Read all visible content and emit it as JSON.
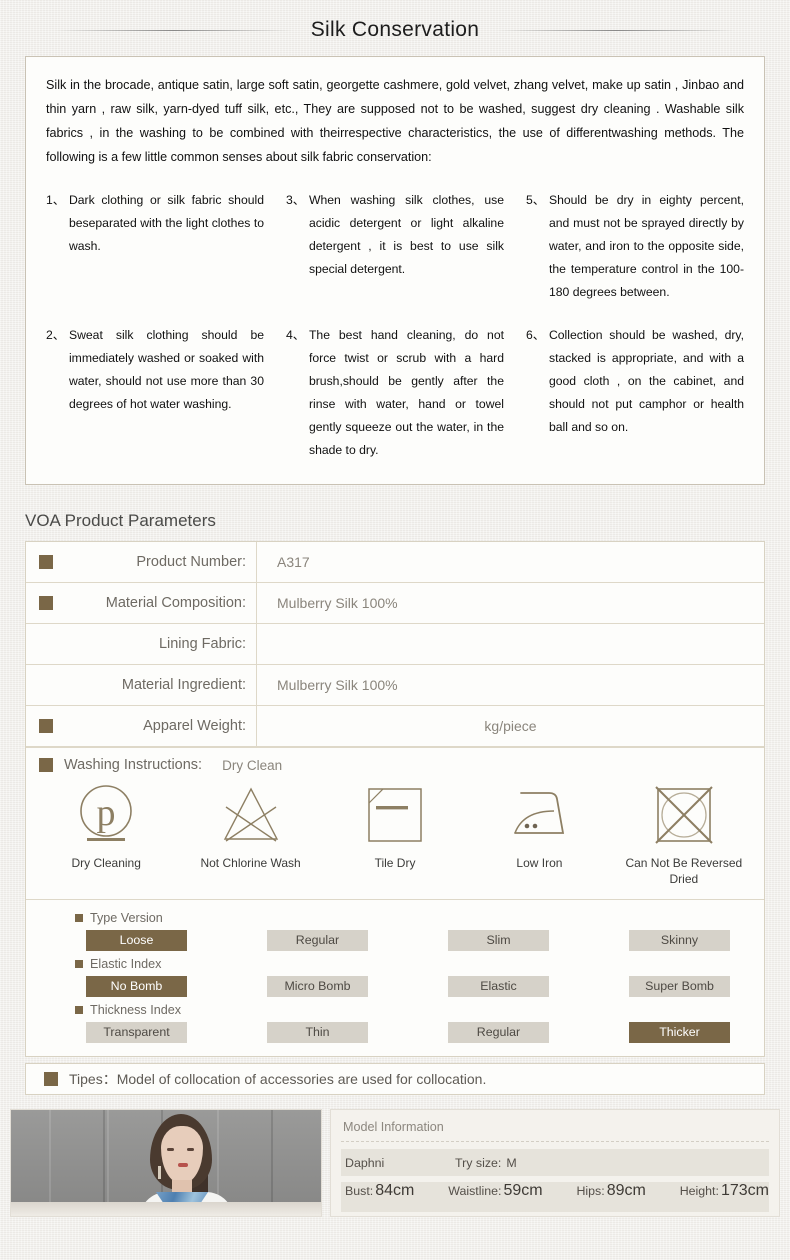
{
  "header": {
    "title": "Silk Conservation"
  },
  "intro": {
    "paragraph": "Silk in the brocade, antique satin, large soft satin, georgette cashmere, gold velvet, zhang velvet, make up satin , Jinbao and thin yarn , raw silk, yarn-dyed tuff silk, etc., They are supposed not to be washed, suggest dry cleaning . Washable silk fabrics , in the washing to be combined with theirrespective characteristics, the use of differentwashing methods. The following is a few little common senses about silk fabric conservation:"
  },
  "tips": [
    {
      "num": "1、",
      "text": "Dark clothing or silk fabric should beseparated with the light clothes to wash."
    },
    {
      "num": "2、",
      "text": "Sweat silk clothing should be immediately washed or soaked with water, should not use more than 30 degrees of hot water washing."
    },
    {
      "num": "3、",
      "text": "When washing silk clothes, use acidic detergent or light alkaline detergent , it is best to use silk special detergent."
    },
    {
      "num": "4、",
      "text": "The best hand cleaning, do not force twist or scrub with a hard brush,should be gently after the rinse with water, hand or towel gently squeeze out the water, in the shade to dry."
    },
    {
      "num": "5、",
      "text": "Should be dry in eighty percent, and must not be sprayed directly by water, and iron to the opposite side, the temperature control in the 100-180 degrees between."
    },
    {
      "num": "6、",
      "text": "Collection should be washed, dry, stacked is appropriate, and with a good cloth , on the cabinet, and should not put camphor or health ball and so on."
    }
  ],
  "parameters": {
    "section_title": "VOA Product Parameters",
    "rows": [
      {
        "label": "Product Number:",
        "value": "A317",
        "marker": true,
        "align": "left"
      },
      {
        "label": "Material Composition:",
        "value": "Mulberry Silk 100%",
        "marker": true,
        "align": "left"
      },
      {
        "label": "Lining Fabric:",
        "value": "",
        "marker": false,
        "align": "left"
      },
      {
        "label": "Material Ingredient:",
        "value": "Mulberry Silk 100%",
        "marker": false,
        "align": "left"
      },
      {
        "label": "Apparel Weight:",
        "value": "kg/piece",
        "marker": true,
        "align": "center"
      }
    ]
  },
  "washing": {
    "title": "Washing Instructions:",
    "subtitle": "Dry Clean",
    "icons": [
      {
        "icon": "dry-cleaning-icon",
        "caption": "Dry Cleaning"
      },
      {
        "icon": "not-chlorine-wash-icon",
        "caption": "Not Chlorine Wash"
      },
      {
        "icon": "tile-dry-icon",
        "caption": "Tile Dry"
      },
      {
        "icon": "low-iron-icon",
        "caption": "Low Iron"
      },
      {
        "icon": "no-tumble-dry-icon",
        "caption": "Can Not Be Reversed Dried"
      }
    ]
  },
  "indices": [
    {
      "label": "Type  Version",
      "options": [
        {
          "text": "Loose",
          "active": true
        },
        {
          "text": "Regular",
          "active": false
        },
        {
          "text": "Slim",
          "active": false
        },
        {
          "text": "Skinny",
          "active": false
        }
      ]
    },
    {
      "label": "Elastic Index",
      "options": [
        {
          "text": "No  Bomb",
          "active": true
        },
        {
          "text": "Micro  Bomb",
          "active": false
        },
        {
          "text": "Elastic",
          "active": false
        },
        {
          "text": "Super  Bomb",
          "active": false
        }
      ]
    },
    {
      "label": "Thickness Index",
      "options": [
        {
          "text": "Transparent",
          "active": false
        },
        {
          "text": "Thin",
          "active": false
        },
        {
          "text": "Regular",
          "active": false
        },
        {
          "text": "Thicker",
          "active": true
        }
      ]
    }
  ],
  "tipes": {
    "text": "Tipes：Model of collocation of accessories are used for collocation."
  },
  "model": {
    "info_title": "Model Information",
    "name": "Daphni",
    "try_size_label": "Try size:",
    "try_size_value": "M",
    "measurements": [
      {
        "key": "Bust:",
        "value": "84cm"
      },
      {
        "key": "Waistline:",
        "value": "59cm"
      },
      {
        "key": "Hips:",
        "value": "89cm"
      },
      {
        "key": "Height:",
        "value": "173cm"
      }
    ]
  },
  "colors": {
    "brand_brown": "#7a6747",
    "chip_inactive": "#d6d2c9",
    "page_bg": "#f1efeb",
    "card_bg": "#fdfdfb",
    "border": "#d8d2c2"
  }
}
